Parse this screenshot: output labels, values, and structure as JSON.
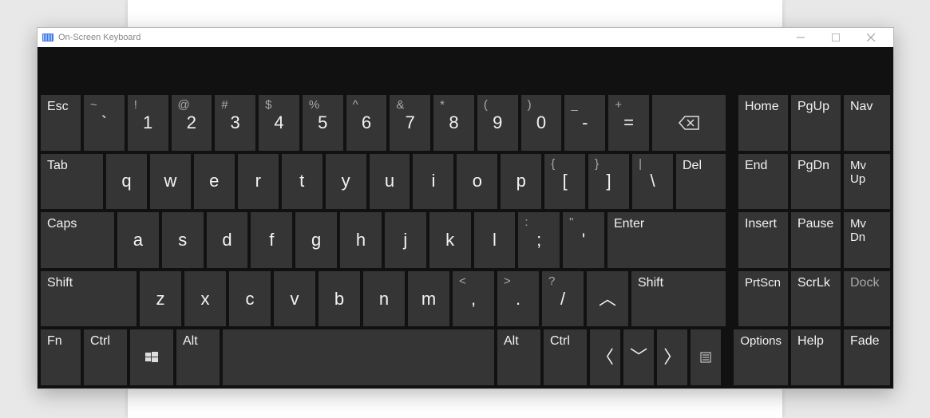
{
  "window": {
    "title": "On-Screen Keyboard"
  },
  "rows": {
    "r1": {
      "esc": "Esc",
      "k1": {
        "sec": "~",
        "pri": "`"
      },
      "k2": {
        "sec": "!",
        "pri": "1"
      },
      "k3": {
        "sec": "@",
        "pri": "2"
      },
      "k4": {
        "sec": "#",
        "pri": "3"
      },
      "k5": {
        "sec": "$",
        "pri": "4"
      },
      "k6": {
        "sec": "%",
        "pri": "5"
      },
      "k7": {
        "sec": "^",
        "pri": "6"
      },
      "k8": {
        "sec": "&",
        "pri": "7"
      },
      "k9": {
        "sec": "*",
        "pri": "8"
      },
      "k10": {
        "sec": "(",
        "pri": "9"
      },
      "k11": {
        "sec": ")",
        "pri": "0"
      },
      "k12": {
        "sec": "_",
        "pri": "-"
      },
      "k13": {
        "sec": "+",
        "pri": "="
      },
      "side": {
        "home": "Home",
        "pgup": "PgUp",
        "nav": "Nav"
      }
    },
    "r2": {
      "tab": "Tab",
      "q": "q",
      "w": "w",
      "e": "e",
      "r": "r",
      "t": "t",
      "y": "y",
      "u": "u",
      "i": "i",
      "o": "o",
      "p": "p",
      "br1": {
        "sec": "{",
        "pri": "["
      },
      "br2": {
        "sec": "}",
        "pri": "]"
      },
      "bs": {
        "sec": "|",
        "pri": "\\"
      },
      "del": "Del",
      "side": {
        "end": "End",
        "pgdn": "PgDn",
        "mvup": "Mv Up"
      }
    },
    "r3": {
      "caps": "Caps",
      "a": "a",
      "s": "s",
      "d": "d",
      "f": "f",
      "g": "g",
      "h": "h",
      "j": "j",
      "k": "k",
      "l": "l",
      "sc": {
        "sec": ":",
        "pri": ";"
      },
      "qt": {
        "sec": "\"",
        "pri": "'"
      },
      "enter": "Enter",
      "side": {
        "insert": "Insert",
        "pause": "Pause",
        "mvdn": "Mv Dn"
      }
    },
    "r4": {
      "shiftL": "Shift",
      "z": "z",
      "x": "x",
      "c": "c",
      "v": "v",
      "b": "b",
      "n": "n",
      "m": "m",
      "cm": {
        "sec": "<",
        "pri": ","
      },
      "dt": {
        "sec": ">",
        "pri": "."
      },
      "sl": {
        "sec": "?",
        "pri": "/"
      },
      "shiftR": "Shift",
      "side": {
        "prtscn": "PrtScn",
        "scrlk": "ScrLk",
        "dock": "Dock"
      }
    },
    "r5": {
      "fn": "Fn",
      "ctrlL": "Ctrl",
      "altL": "Alt",
      "altR": "Alt",
      "ctrlR": "Ctrl",
      "side": {
        "options": "Options",
        "help": "Help",
        "fade": "Fade"
      }
    }
  }
}
